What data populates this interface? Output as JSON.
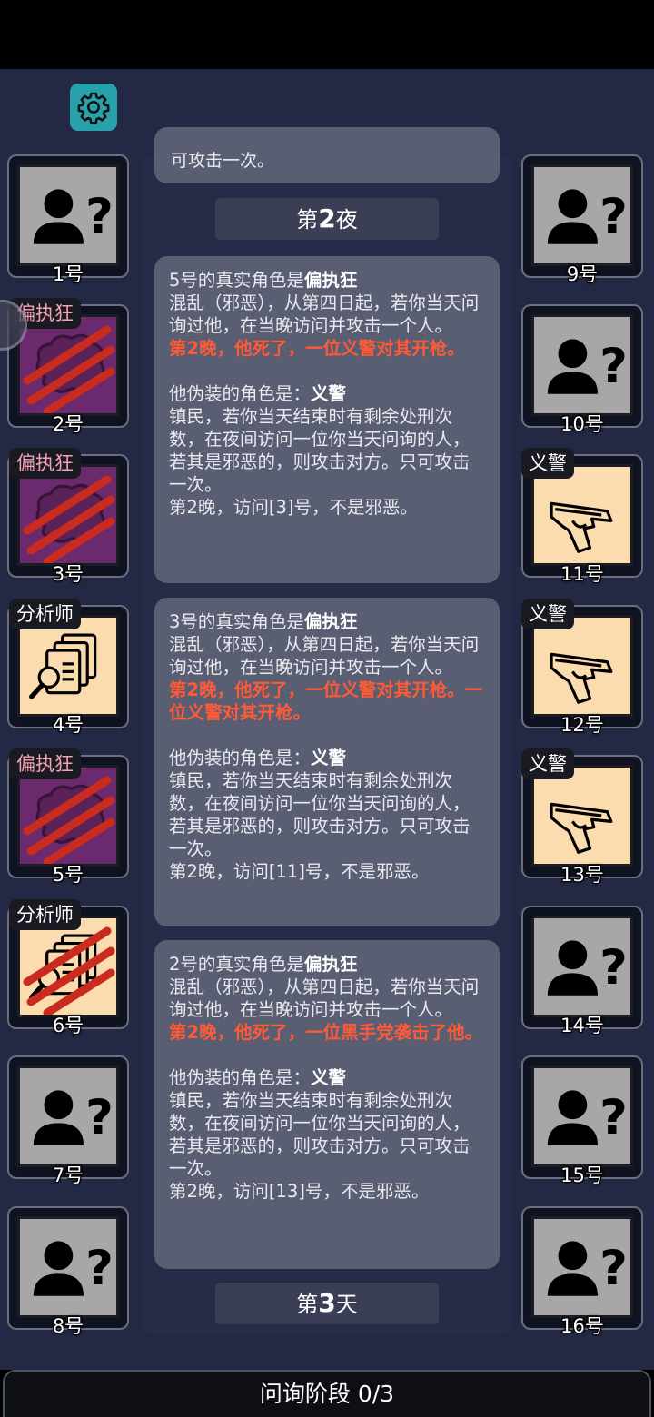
{
  "settings": {
    "icon": "gear-icon"
  },
  "left_players": [
    {
      "num": "1号",
      "tag": "",
      "type": "unknown",
      "slashed": false
    },
    {
      "num": "2号",
      "tag": "偏执狂",
      "type": "paranoid",
      "slashed": true
    },
    {
      "num": "3号",
      "tag": "偏执狂",
      "type": "paranoid",
      "slashed": true
    },
    {
      "num": "4号",
      "tag": "分析师",
      "type": "analyst",
      "slashed": false
    },
    {
      "num": "5号",
      "tag": "偏执狂",
      "type": "paranoid",
      "slashed": true
    },
    {
      "num": "6号",
      "tag": "分析师",
      "type": "analyst",
      "slashed": true
    },
    {
      "num": "7号",
      "tag": "",
      "type": "unknown",
      "slashed": false
    },
    {
      "num": "8号",
      "tag": "",
      "type": "unknown",
      "slashed": false
    }
  ],
  "right_players": [
    {
      "num": "9号",
      "tag": "",
      "type": "unknown",
      "slashed": false
    },
    {
      "num": "10号",
      "tag": "",
      "type": "unknown",
      "slashed": false
    },
    {
      "num": "11号",
      "tag": "义警",
      "type": "vigilante",
      "slashed": false
    },
    {
      "num": "12号",
      "tag": "义警",
      "type": "vigilante",
      "slashed": false
    },
    {
      "num": "13号",
      "tag": "义警",
      "type": "vigilante",
      "slashed": false
    },
    {
      "num": "14号",
      "tag": "",
      "type": "unknown",
      "slashed": false
    },
    {
      "num": "15号",
      "tag": "",
      "type": "unknown",
      "slashed": false
    },
    {
      "num": "16号",
      "tag": "",
      "type": "unknown",
      "slashed": false
    }
  ],
  "log": {
    "prev_fragment": "可攻击一次。",
    "night_label_pre": "第",
    "night_label_num": "2",
    "night_label_post": "夜",
    "day_label_pre": "第",
    "day_label_num": "3",
    "day_label_post": "天",
    "messages": [
      {
        "title_pre": "5号的真实角色是",
        "title_role": "偏执狂",
        "desc": "混乱（邪恶），从第四日起，若你当天问询过他，在当晚访问并攻击一个人。",
        "death": "第2晚，他死了，一位义警对其开枪。",
        "disguise_pre": "他伪装的角色是：",
        "disguise_role": "义警",
        "disguise_desc": "镇民，若你当天结束时有剩余处刑次数，在夜间访问一位你当天问询的人，若其是邪恶的，则攻击对方。只可攻击一次。",
        "visit": "第2晚，访问[3]号，不是邪恶。"
      },
      {
        "title_pre": "3号的真实角色是",
        "title_role": "偏执狂",
        "desc": "混乱（邪恶），从第四日起，若你当天问询过他，在当晚访问并攻击一个人。",
        "death": "第2晚，他死了，一位义警对其开枪。一位义警对其开枪。",
        "disguise_pre": "他伪装的角色是：",
        "disguise_role": "义警",
        "disguise_desc": "镇民，若你当天结束时有剩余处刑次数，在夜间访问一位你当天问询的人，若其是邪恶的，则攻击对方。只可攻击一次。",
        "visit": "第2晚，访问[11]号，不是邪恶。"
      },
      {
        "title_pre": "2号的真实角色是",
        "title_role": "偏执狂",
        "desc": "混乱（邪恶），从第四日起，若你当天问询过他，在当晚访问并攻击一个人。",
        "death": "第2晚，他死了，一位黑手党袭击了他。",
        "disguise_pre": "他伪装的角色是：",
        "disguise_role": "义警",
        "disguise_desc": "镇民，若你当天结束时有剩余处刑次数，在夜间访问一位你当天问询的人，若其是邪恶的，则攻击对方。只可攻击一次。",
        "visit": "第2晚，访问[13]号，不是邪恶。"
      }
    ]
  },
  "bottom": {
    "phase": "问询阶段 0/3"
  }
}
